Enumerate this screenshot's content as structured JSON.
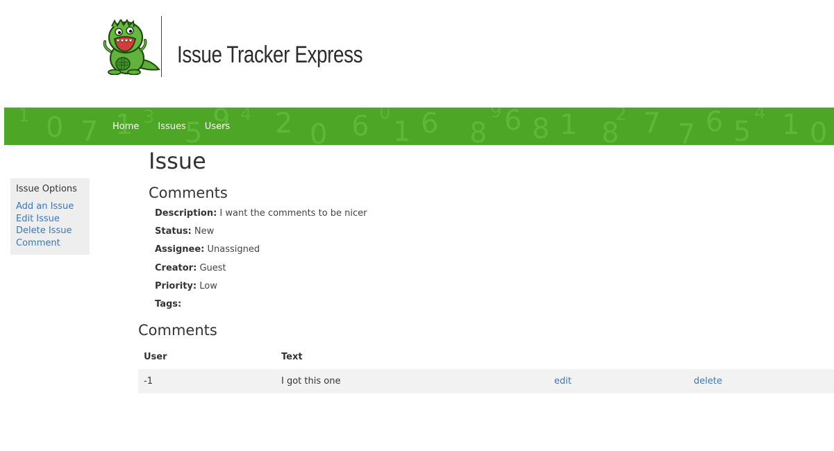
{
  "header": {
    "title": "Issue Tracker Express"
  },
  "nav": {
    "items": [
      {
        "label": "Home"
      },
      {
        "label": "Issues"
      },
      {
        "label": "Users"
      }
    ]
  },
  "sidebar": {
    "title": "Issue Options",
    "items": [
      {
        "label": "Add an Issue"
      },
      {
        "label": "Edit Issue"
      },
      {
        "label": "Delete Issue"
      },
      {
        "label": "Comment"
      }
    ]
  },
  "main": {
    "title": "Issue",
    "section_title": "Comments",
    "details": [
      {
        "label": "Description:",
        "value": "I want the comments to be nicer"
      },
      {
        "label": "Status:",
        "value": "New"
      },
      {
        "label": "Assignee:",
        "value": "Unassigned"
      },
      {
        "label": "Creator:",
        "value": "Guest"
      },
      {
        "label": "Priority:",
        "value": "Low"
      },
      {
        "label": "Tags:",
        "value": ""
      }
    ],
    "comments": {
      "title": "Comments",
      "columns": [
        "User",
        "Text"
      ],
      "rows": [
        {
          "user": "-1",
          "text": "I got this one",
          "edit": "edit",
          "delete": "delete"
        }
      ]
    }
  },
  "colors": {
    "nav_green": "#4ea626",
    "link": "#3a77b8",
    "sidebar_bg": "#eeeeee"
  }
}
